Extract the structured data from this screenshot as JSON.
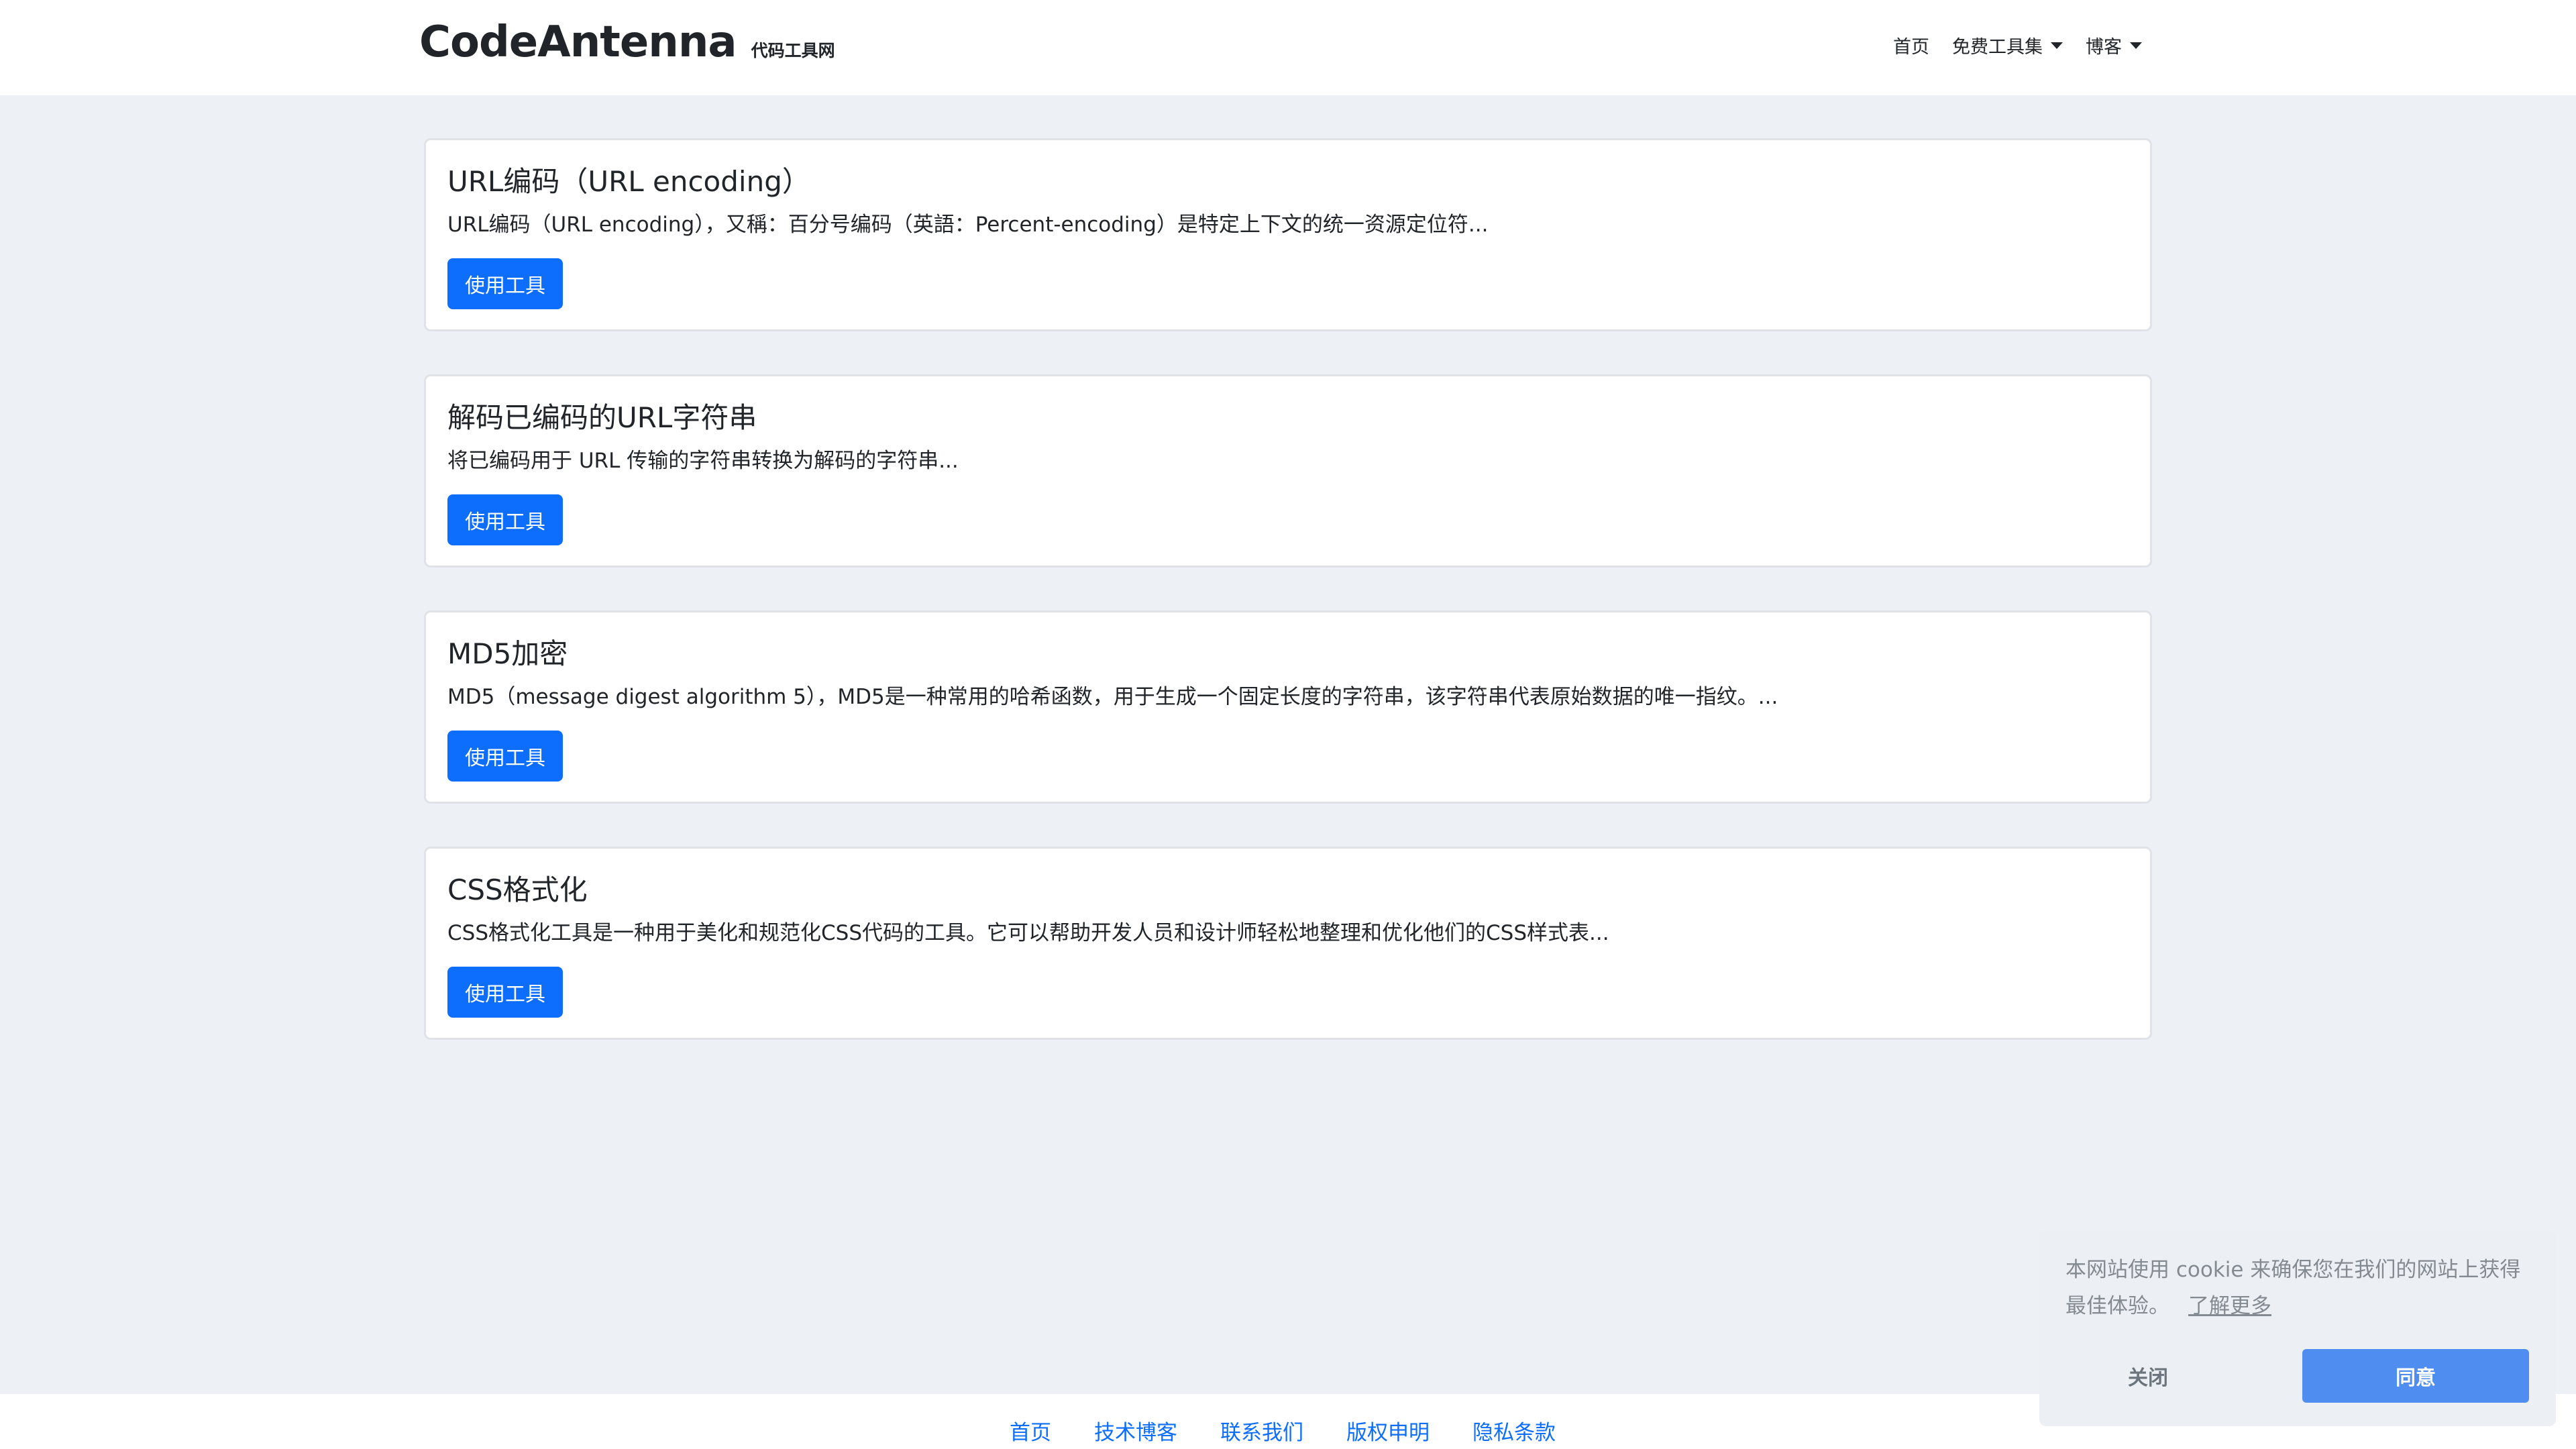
{
  "header": {
    "brand_name": "CodeAntenna",
    "brand_subtitle": "代码工具网",
    "nav": [
      {
        "label": "首页",
        "dropdown": false
      },
      {
        "label": "免费工具集",
        "dropdown": true
      },
      {
        "label": "博客",
        "dropdown": true
      }
    ]
  },
  "cards": [
    {
      "title": "URL编码（URL encoding）",
      "description": "URL编码（URL encoding），又稱：百分号编码（英語：Percent-encoding）是特定上下文的统一资源定位符...",
      "button_label": "使用工具"
    },
    {
      "title": "解码已编码的URL字符串",
      "description": "将已编码用于 URL 传输的字符串转换为解码的字符串...",
      "button_label": "使用工具"
    },
    {
      "title": "MD5加密",
      "description": "MD5（message digest algorithm 5），MD5是一种常用的哈希函数，用于生成一个固定长度的字符串，该字符串代表原始数据的唯一指纹。...",
      "button_label": "使用工具"
    },
    {
      "title": "CSS格式化",
      "description": "CSS格式化工具是一种用于美化和规范化CSS代码的工具。它可以帮助开发人员和设计师轻松地整理和优化他们的CSS样式表...",
      "button_label": "使用工具"
    }
  ],
  "footer": {
    "links": [
      "首页",
      "技术博客",
      "联系我们",
      "版权申明",
      "隐私条款"
    ]
  },
  "cookie_banner": {
    "message": "本网站使用 cookie 来确保您在我们的网站上获得最佳体验。",
    "learn_more": "了解更多",
    "dismiss": "关闭",
    "allow": "同意"
  },
  "colors": {
    "primary": "#0d6efd",
    "page_background": "#edf1f5",
    "cookie_allow": "#4f8ef0"
  }
}
